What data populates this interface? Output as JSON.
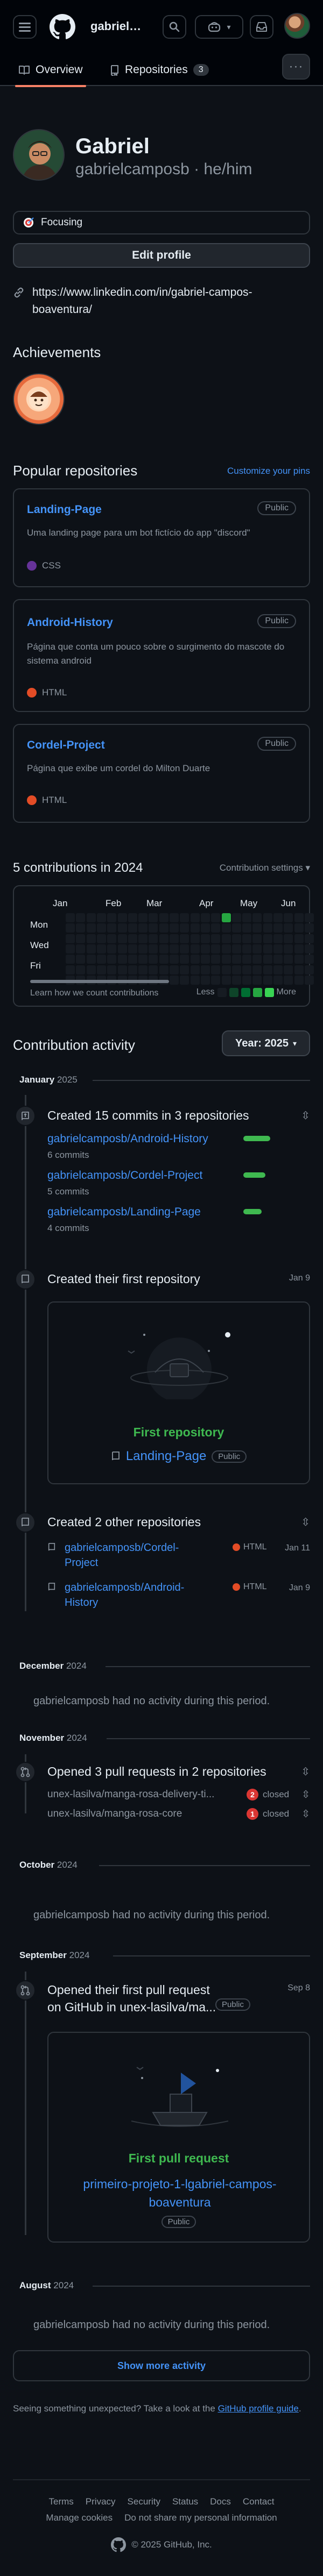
{
  "header": {
    "username_short": "gabrielc...",
    "tabs": [
      {
        "label": "Overview"
      },
      {
        "label": "Repositories",
        "count": "3"
      }
    ]
  },
  "profile": {
    "name": "Gabriel",
    "login": "gabrielcamposb · he/him",
    "status": "Focusing",
    "edit_label": "Edit profile",
    "link": "https://www.linkedin.com/in/gabriel-campos-boaventura/"
  },
  "achievements": {
    "title": "Achievements"
  },
  "popular": {
    "title": "Popular repositories",
    "customize": "Customize your pins",
    "repos": [
      {
        "name": "Landing-Page",
        "visibility": "Public",
        "desc": "Uma landing page para um bot fictício do app \"discord\"",
        "lang": "CSS",
        "lang_color": "#663399"
      },
      {
        "name": "Android-History",
        "visibility": "Public",
        "desc": "Página que conta um pouco sobre o surgimento do mascote do sistema android",
        "lang": "HTML",
        "lang_color": "#e34c26"
      },
      {
        "name": "Cordel-Project",
        "visibility": "Public",
        "desc": "Página que exibe um cordel do Milton Duarte",
        "lang": "HTML",
        "lang_color": "#e34c26"
      }
    ]
  },
  "contributions": {
    "title": "5 contributions in 2024",
    "settings": "Contribution settings ▾",
    "months": [
      "Jan",
      "Feb",
      "Mar",
      "Apr",
      "May",
      "Jun"
    ],
    "days": [
      "Mon",
      "Wed",
      "Fri"
    ],
    "learn": "Learn how we count contributions",
    "less": "Less",
    "more": "More"
  },
  "activity": {
    "title": "Contribution activity",
    "year_btn": "Year: 2025",
    "january": {
      "month": "January",
      "year": "2025"
    },
    "commits_head": "Created 15 commits in 3 repositories",
    "commit_rows": [
      {
        "repo": "gabrielcamposb/Android-History",
        "count": "6 commits",
        "fraction": 0.4
      },
      {
        "repo": "gabrielcamposb/Cordel-Project",
        "count": "5 commits",
        "fraction": 0.33
      },
      {
        "repo": "gabrielcamposb/Landing-Page",
        "count": "4 commits",
        "fraction": 0.27
      }
    ],
    "first_repo_head": "Created their first repository",
    "first_repo_date": "Jan 9",
    "first_repo_card_title": "First repository",
    "first_repo_card_repo": "Landing-Page",
    "first_repo_card_badge": "Public",
    "other_repos_head": "Created 2 other repositories",
    "other_repos": [
      {
        "name": "gabrielcamposb/Cordel-Project",
        "lang": "HTML",
        "date": "Jan 11"
      },
      {
        "name": "gabrielcamposb/Android-History",
        "lang": "HTML",
        "date": "Jan 9"
      }
    ],
    "december": {
      "month": "December",
      "year": "2024"
    },
    "no_activity": "gabrielcamposb had no activity during this period.",
    "november": {
      "month": "November",
      "year": "2024"
    },
    "pr_head": "Opened 3 pull requests in 2 repositories",
    "pr_rows": [
      {
        "name": "unex-lasilva/manga-rosa-delivery-ti...",
        "closed_count": "2",
        "closed_label": "closed"
      },
      {
        "name": "unex-lasilva/manga-rosa-core",
        "closed_count": "1",
        "closed_label": "closed"
      }
    ],
    "october": {
      "month": "October",
      "year": "2024"
    },
    "september": {
      "month": "September",
      "year": "2024"
    },
    "first_pr_head": "Opened their first pull request on GitHub in unex-lasilva/ma...",
    "first_pr_badge": "Public",
    "first_pr_date": "Sep 8",
    "first_pr_card_title": "First pull request",
    "first_pr_card_link": "primeiro-projeto-1-lgabriel-campos-boaventura",
    "first_pr_card_badge": "Public",
    "august": {
      "month": "August",
      "year": "2024"
    },
    "show_more": "Show more activity"
  },
  "unexpected": {
    "text": "Seeing something unexpected? Take a look at the ",
    "link": "GitHub profile guide",
    "end": "."
  },
  "footer": {
    "row1": [
      "Terms",
      "Privacy",
      "Security",
      "Status",
      "Docs",
      "Contact"
    ],
    "row2": [
      "Manage cookies",
      "Do not share my personal information"
    ],
    "copyright": "© 2025 GitHub, Inc."
  },
  "colors": {
    "accent": "#4493f8",
    "green": "#3fb950",
    "closed": "#da3633",
    "tab_underline": "#f78166"
  }
}
